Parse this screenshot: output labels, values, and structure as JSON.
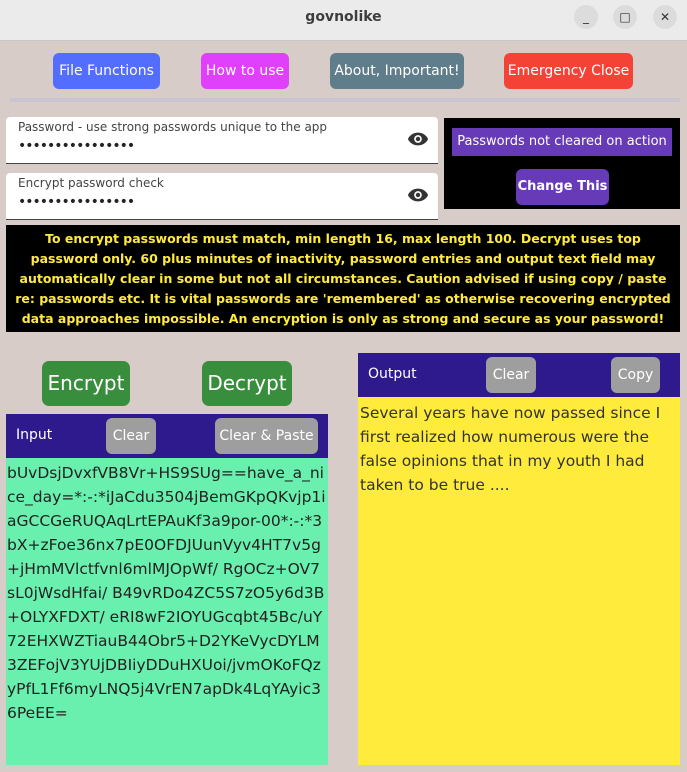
{
  "window": {
    "title": "govnolike",
    "minimize_glyph": "_",
    "maximize_glyph": "□",
    "close_glyph": "✕"
  },
  "toolbar": {
    "file_functions": {
      "label": "File Functions",
      "color": "#536dfe"
    },
    "how_to_use": {
      "label": "How to use",
      "color": "#e040fb"
    },
    "about": {
      "label": "About, Important!",
      "color": "#607d8b"
    },
    "emergency_close": {
      "label": "Emergency Close",
      "color": "#f44336"
    }
  },
  "password": {
    "label": "Password - use strong passwords unique to the app",
    "value": "••••••••••••••••",
    "visibility_icon": "eye-icon"
  },
  "password_check": {
    "label": "Encrypt password check",
    "value": "••••••••••••••••",
    "visibility_icon": "eye-icon"
  },
  "password_policy": {
    "status": "Passwords not cleared on action",
    "change_label": "Change This"
  },
  "warning_text": "To encrypt passwords must match, min length 16, max length 100.  Decrypt uses top password only.  60 plus minutes of inactivity, password entries and output text field may automatically clear in some but not all circumstances.  Caution advised if using copy / paste re: passwords etc.  It is vital passwords are 'remembered' as otherwise recovering encrypted data approaches impossible.  An encryption is only as strong and secure as your password!",
  "actions": {
    "encrypt": "Encrypt",
    "decrypt": "Decrypt"
  },
  "input_panel": {
    "title": "Input",
    "clear": "Clear",
    "clear_paste": "Clear & Paste",
    "text": "bUvDsjDvxfVB8Vr+HS9SUg==have_a_nice_day=*:-:*iJaCdu3504jBemGKpQKvjp1iaGCCGeRUQAqLrtEPAuKf3a9por-00*:-:*3bX+zFoe36nx7pE0OFDJUunVyv4HT7v5g+jHmMVlctfvnl6mlMJOpWf/ RgOCz+OV7sL0jWsdHfai/ B49vRDo4ZC5S7zO5y6d3B+OLYXFDXT/ eRI8wF2IOYUGcqbt45Bc/uY72EHXWZTiauB44Obr5+D2YKeVycDYLM3ZEFojV3YUjDBIiyDDuHXUoi/jvmOKoFQzyPfL1Ff6myLNQ5j4VrEN7apDk4LqYAyic36PeEE="
  },
  "output_panel": {
    "title": "Output",
    "clear": "Clear",
    "copy": "Copy",
    "text": "Several years have now passed since I first realized how numerous were the false opinions that in my youth I had taken to be true ...."
  }
}
